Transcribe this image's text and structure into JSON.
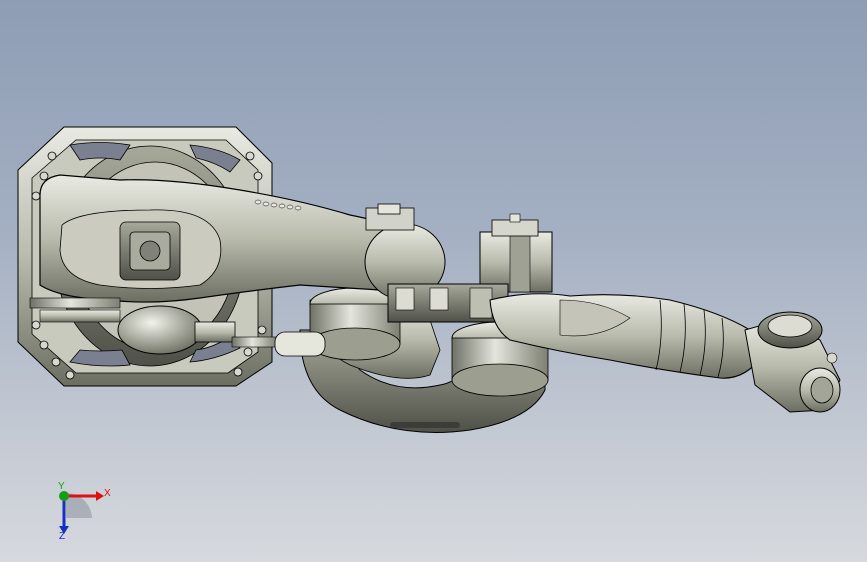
{
  "viewport": {
    "background_top": "#8e9db4",
    "background_bottom": "#d6d9de"
  },
  "model": {
    "part_color": "#bfc0b2",
    "edge_color": "#000000"
  },
  "triad": {
    "x_label": "X",
    "y_label": "Y",
    "z_label": "Z",
    "x_color": "#e01010",
    "y_color": "#12a012",
    "z_color": "#1830c0"
  }
}
